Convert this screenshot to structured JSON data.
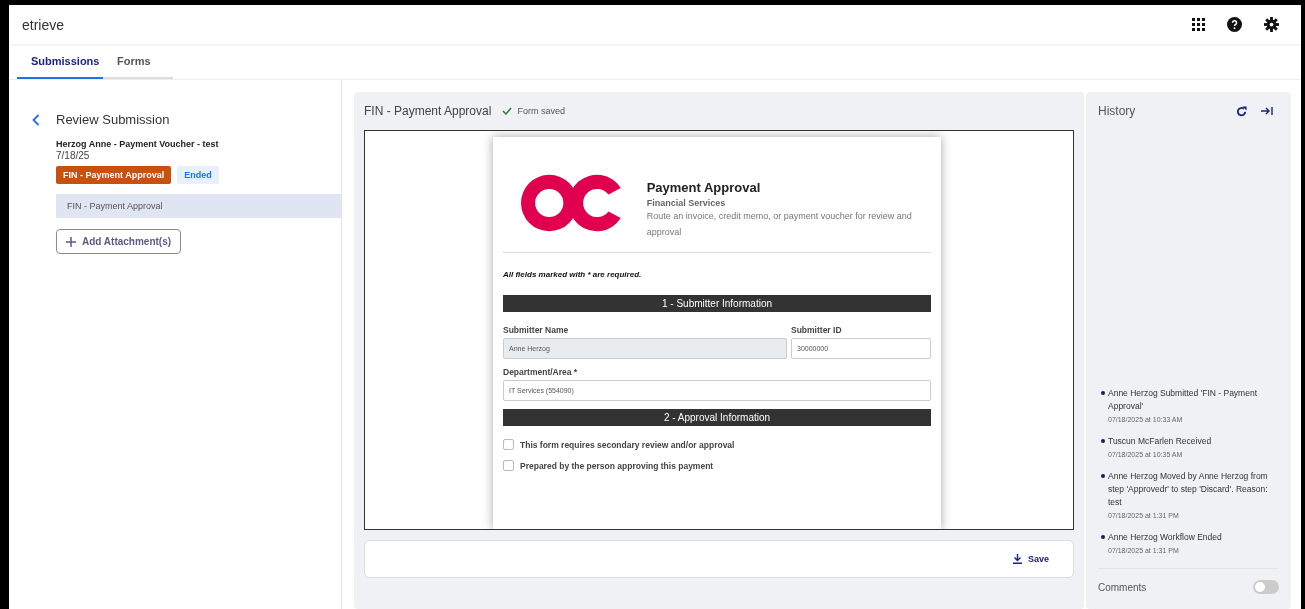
{
  "app": {
    "logo": "etrieve"
  },
  "tabs": [
    {
      "label": "Submissions",
      "selected": true
    },
    {
      "label": "Forms",
      "selected": false
    }
  ],
  "submission": {
    "title": "Review Submission",
    "name": "Herzog Anne - Payment Voucher - test",
    "date": "7/18/25",
    "form_badge": "FIN - Payment Approval",
    "status_badge": "Ended",
    "items": [
      {
        "label": "FIN - Payment Approval",
        "selected": true
      }
    ],
    "add_button": "Add Attachment(s)"
  },
  "form_panel": {
    "title": "FIN - Payment Approval",
    "status": "Form saved",
    "document": {
      "heading": "Payment Approval",
      "subheading": "Financial Services",
      "description": "Route an invoice, credit memo, or payment voucher for review and approval",
      "required_note": "All fields marked with * are required.",
      "sections": [
        {
          "title": "1 - Submitter Information",
          "rows": [
            [
              {
                "label": "Submitter Name",
                "value": "Anne Herzog",
                "disabled": true
              },
              {
                "label": "Submitter ID",
                "value": "30000000",
                "disabled": false
              }
            ],
            [
              {
                "label": "Department/Area *",
                "value": "IT Services (554090)",
                "disabled": false
              }
            ]
          ]
        },
        {
          "title": "2 - Approval Information",
          "checkboxes": [
            {
              "label": "This form requires secondary review and/or approval",
              "checked": false
            },
            {
              "label": "Prepared by the person approving this payment",
              "checked": false
            }
          ]
        }
      ]
    },
    "save_button": "Save"
  },
  "history": {
    "title": "History",
    "events": [
      {
        "text": "Anne Herzog Submitted 'FIN - Payment Approval'",
        "time": "07/18/2025 at 10:33 AM"
      },
      {
        "text": "Tuscun McFarlen Received",
        "time": "07/18/2025 at 10:35 AM"
      },
      {
        "text": "Anne Herzog Moved by Anne Herzog from step 'Approvedr' to step 'Discard'. Reason: test",
        "time": "07/18/2025 at 1:31 PM"
      },
      {
        "text": "Anne Herzog Workflow Ended",
        "time": "07/18/2025 at 1:31 PM"
      }
    ],
    "comments": {
      "label": "Comments",
      "on": false
    }
  }
}
